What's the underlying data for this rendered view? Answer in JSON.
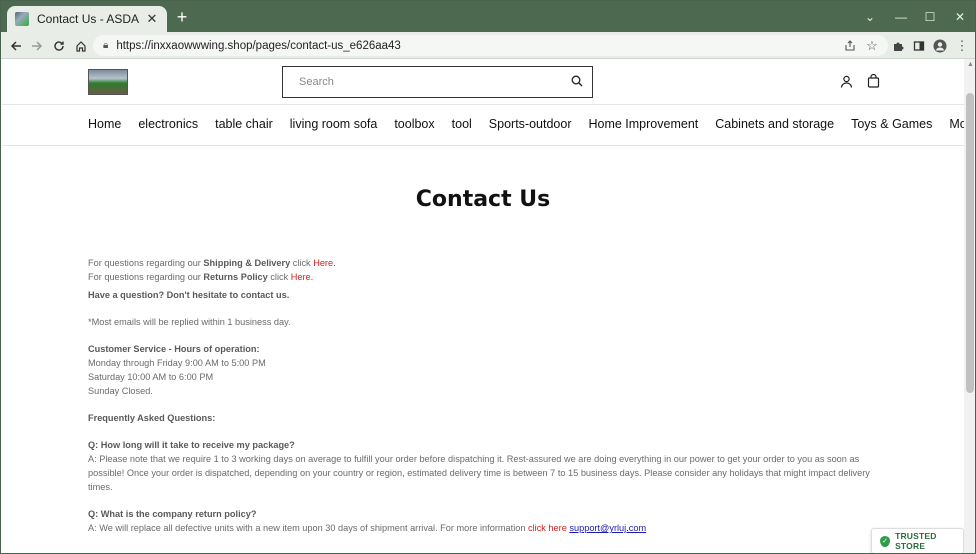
{
  "browser": {
    "tab_title": "Contact Us - ASDA",
    "tab_close": "✕",
    "new_tab": "+",
    "url": "https://inxxaowwwing.shop/pages/contact-us_e626aa43",
    "window_controls": {
      "collapse": "⌄",
      "minimize": "—",
      "maximize": "☐",
      "close": "✕"
    }
  },
  "header": {
    "search_placeholder": "Search"
  },
  "nav": {
    "items": [
      "Home",
      "electronics",
      "table chair",
      "living room sofa",
      "toolbox",
      "tool",
      "Sports-outdoor",
      "Home Improvement",
      "Cabinets and storage",
      "Toys & Games",
      "More link"
    ]
  },
  "page": {
    "title": "Contact Us",
    "shipping_prefix": "For questions regarding our ",
    "shipping_bold": "Shipping & Delivery",
    "shipping_click": " click ",
    "shipping_link": "Here.",
    "returns_prefix": "For questions regarding our ",
    "returns_bold": "Returns Policy",
    "returns_click": " click ",
    "returns_link": "Here.",
    "question_line": "Have a question?  Don't hesitate to contact us.",
    "reply_note": "*Most emails will be replied within 1 business day.",
    "hours_heading": "Customer Service - Hours of operation:",
    "hours": [
      "Monday through Friday 9:00 AM to 5:00 PM",
      "Saturday 10:00 AM to 6:00 PM",
      "Sunday Closed."
    ],
    "faq_heading": "Frequently Asked Questions:",
    "q1": "Q: How long will it take to receive my package?",
    "a1": "A: Please note that we require 1 to 3 working days on average to fulfill your order before dispatching it.  Rest-assured we are doing everything in our power to get your order to you as soon as possible!  Once your order is dispatched, depending on your country or region, estimated delivery time is between 7 to 15 business days.  Please consider any holidays that might impact delivery times.",
    "q2": "Q: What is the company return policy?",
    "a2_prefix": "A: We will replace all defective units with a new item upon 30 days of shipment arrival.  For more information ",
    "a2_link": "click here",
    "a2_email": "support@yrluj.com"
  },
  "badge": {
    "label": "TRUSTED STORE"
  },
  "icons": {
    "search": "search-icon",
    "account": "account-icon",
    "cart": "bag-icon"
  }
}
